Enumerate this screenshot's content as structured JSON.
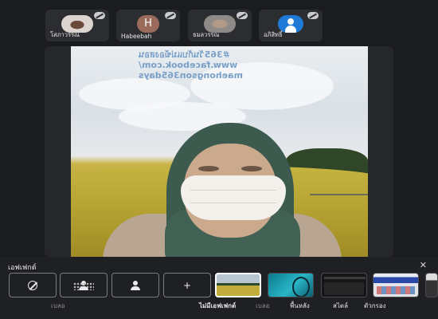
{
  "participants": [
    {
      "name": "โสภาวรรณ",
      "avatar": "photo",
      "muted": true
    },
    {
      "name": "Habeebah",
      "avatar": "letter",
      "initial": "H",
      "muted": true
    },
    {
      "name": "ธมลวรรณ",
      "avatar": "photo",
      "muted": true
    },
    {
      "name": "อภิสิทธิ์",
      "avatar": "user-icon",
      "muted": true
    }
  ],
  "video": {
    "watermark_lines": [
      "#365วันกับแม่ฆ้องสอน",
      "www.facebook.com/",
      "maehongson365days"
    ]
  },
  "effects_panel": {
    "title": "เอฟเฟกต์",
    "close_icon": "close-icon",
    "options": [
      {
        "icon": "no-effect-icon"
      },
      {
        "icon": "blur-background-icon"
      },
      {
        "icon": "blur-person-icon"
      },
      {
        "icon": "add-icon"
      }
    ],
    "labels": {
      "blur": "เบลอ",
      "none_effect": "ไม่มีเอฟเฟกต์",
      "blur2": "เบลอ",
      "background": "พื้นหลัง",
      "style": "สไตล์",
      "filter": "ตัวกรอง"
    },
    "selected": "ไม่มีเอฟเฟกต์"
  }
}
